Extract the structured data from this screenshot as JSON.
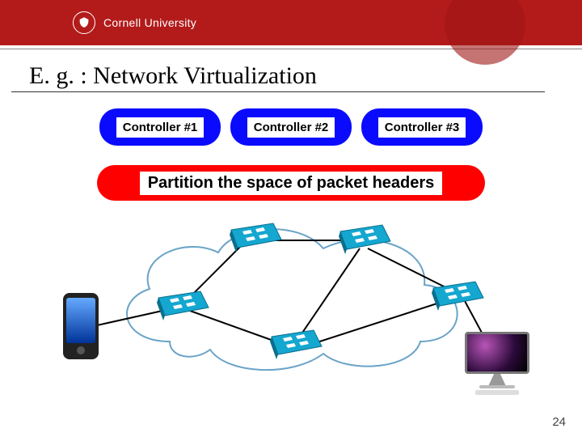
{
  "header": {
    "university": "Cornell University"
  },
  "title": "E. g. : Network Virtualization",
  "controllers": [
    {
      "label": "Controller #1"
    },
    {
      "label": "Controller #2"
    },
    {
      "label": "Controller #3"
    }
  ],
  "partition_label": "Partition the space of packet headers",
  "page_number": "24",
  "diagram": {
    "cloud": "network-cloud",
    "nodes": {
      "phone": "smartphone-client",
      "imac": "desktop-client",
      "switches": [
        "switch-top-left",
        "switch-top-right",
        "switch-right",
        "switch-bottom",
        "switch-left"
      ]
    }
  }
}
